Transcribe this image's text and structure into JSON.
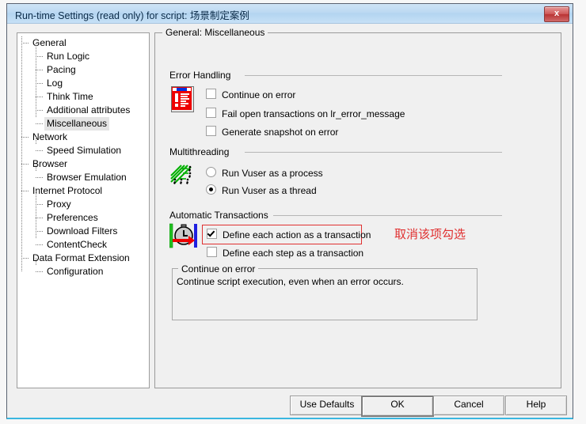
{
  "window": {
    "title": "Run-time Settings (read only) for script: 场景制定案例",
    "close_label": "x"
  },
  "tree": {
    "items": [
      {
        "label": "General",
        "level": 0,
        "selected": false
      },
      {
        "label": "Run Logic",
        "level": 1,
        "selected": false
      },
      {
        "label": "Pacing",
        "level": 1,
        "selected": false
      },
      {
        "label": "Log",
        "level": 1,
        "selected": false
      },
      {
        "label": "Think Time",
        "level": 1,
        "selected": false
      },
      {
        "label": "Additional attributes",
        "level": 1,
        "selected": false
      },
      {
        "label": "Miscellaneous",
        "level": 1,
        "selected": true
      },
      {
        "label": "Network",
        "level": 0,
        "selected": false
      },
      {
        "label": "Speed Simulation",
        "level": 1,
        "selected": false
      },
      {
        "label": "Browser",
        "level": 0,
        "selected": false
      },
      {
        "label": "Browser Emulation",
        "level": 1,
        "selected": false
      },
      {
        "label": "Internet Protocol",
        "level": 0,
        "selected": false
      },
      {
        "label": "Proxy",
        "level": 1,
        "selected": false
      },
      {
        "label": "Preferences",
        "level": 1,
        "selected": false
      },
      {
        "label": "Download Filters",
        "level": 1,
        "selected": false
      },
      {
        "label": "ContentCheck",
        "level": 1,
        "selected": false
      },
      {
        "label": "Data Format Extension",
        "level": 0,
        "selected": false
      },
      {
        "label": "Configuration",
        "level": 1,
        "selected": false
      }
    ]
  },
  "main": {
    "legend": "General: Miscellaneous",
    "error_handling": {
      "title": "Error Handling",
      "icon": "error-page-icon",
      "options": [
        {
          "label": "Continue on error",
          "checked": false
        },
        {
          "label": "Fail open transactions on lr_error_message",
          "checked": false
        },
        {
          "label": "Generate snapshot on error",
          "checked": false
        }
      ]
    },
    "multithreading": {
      "title": "Multithreading",
      "icon": "threads-runners-icon",
      "options": [
        {
          "label": "Run Vuser as a process",
          "selected": false
        },
        {
          "label": "Run Vuser as a thread",
          "selected": true
        }
      ]
    },
    "automatic_transactions": {
      "title": "Automatic Transactions",
      "icon": "stopwatch-icon",
      "options": [
        {
          "label": "Define each action as a transaction",
          "checked": true
        },
        {
          "label": "Define each step as a transaction",
          "checked": false
        }
      ]
    },
    "description": {
      "legend": "Continue on error",
      "text": "Continue script execution, even when an error occurs."
    }
  },
  "annotation": {
    "text": "取消该项勾选",
    "color": "#e03030"
  },
  "buttons": [
    {
      "label": "Use Defaults",
      "default": false
    },
    {
      "label": "OK",
      "default": true
    },
    {
      "label": "Cancel",
      "default": false
    },
    {
      "label": "Help",
      "default": false
    }
  ]
}
